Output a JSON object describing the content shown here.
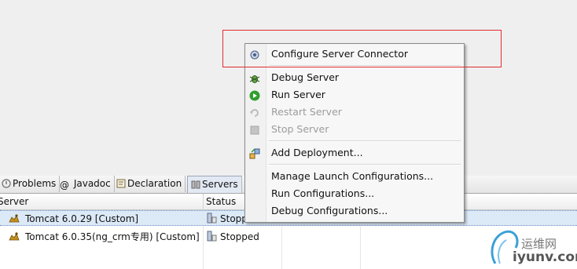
{
  "tabs": [
    {
      "label": "Problems",
      "icon": "problems-icon"
    },
    {
      "label": "Javadoc",
      "icon": "at-icon"
    },
    {
      "label": "Declaration",
      "icon": "declaration-icon"
    },
    {
      "label": "Servers",
      "icon": "servers-icon",
      "active": true
    }
  ],
  "table": {
    "columns": [
      "Server",
      "Status"
    ],
    "rows": [
      {
        "name": "Tomcat  6.0.29  [Custom]",
        "status": "Stopped",
        "selected": true
      },
      {
        "name": "Tomcat  6.0.35(ng_crm专用)  [Custom]",
        "status": "Stopped",
        "selected": false
      }
    ]
  },
  "context_menu": {
    "items": [
      {
        "label": "Configure Server Connector",
        "icon": "connector-icon",
        "enabled": true
      },
      {
        "label": "Debug Server",
        "icon": "bug-icon",
        "enabled": true
      },
      {
        "label": "Run Server",
        "icon": "run-icon",
        "enabled": true
      },
      {
        "label": "Restart Server",
        "icon": "restart-icon",
        "enabled": false
      },
      {
        "label": "Stop Server",
        "icon": "stop-icon",
        "enabled": false
      },
      {
        "label": "Add Deployment...",
        "icon": "deploy-icon",
        "enabled": true
      },
      {
        "label": "Manage Launch Configurations...",
        "enabled": true
      },
      {
        "label": "Run Configurations...",
        "enabled": true
      },
      {
        "label": "Debug Configurations...",
        "enabled": true
      }
    ]
  },
  "watermark": {
    "line1": "运维网",
    "line2": "iyunv.com"
  },
  "colors": {
    "highlight_box": "#e22b2b",
    "selection": "#dce9f7",
    "run_green": "#2f9e2f"
  }
}
